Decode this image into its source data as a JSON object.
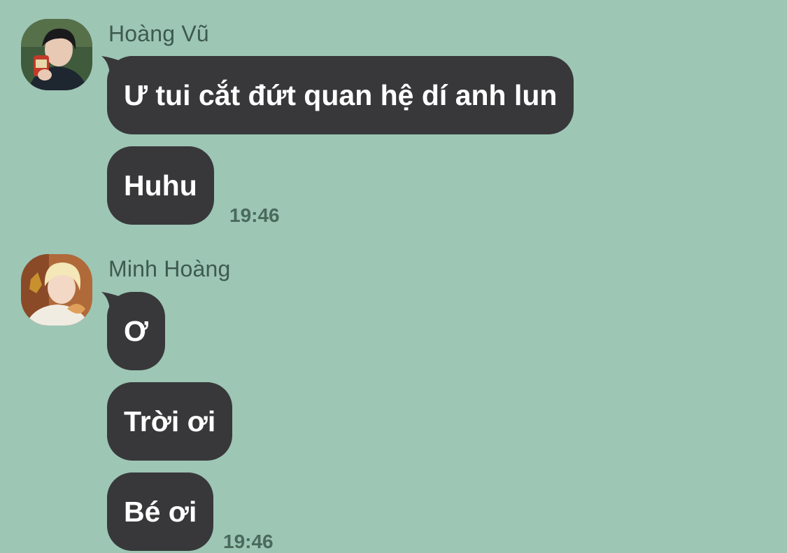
{
  "groups": [
    {
      "sender": "Hoàng Vũ",
      "avatar_icon": "user-avatar-dark-hair",
      "messages": [
        "Ư tui cắt đứt quan hệ dí anh lun",
        "Huhu"
      ],
      "time": "19:46"
    },
    {
      "sender": "Minh Hoàng",
      "avatar_icon": "user-avatar-blonde-hair",
      "messages": [
        "Ơ",
        "Trời ơi",
        "Bé ơi"
      ],
      "time": "19:46"
    }
  ],
  "colors": {
    "background": "#9dc6b5",
    "bubble": "#38383a",
    "bubble_text": "#ffffff",
    "name_text": "#3e5a4e",
    "time_text": "#4a6a5c"
  }
}
